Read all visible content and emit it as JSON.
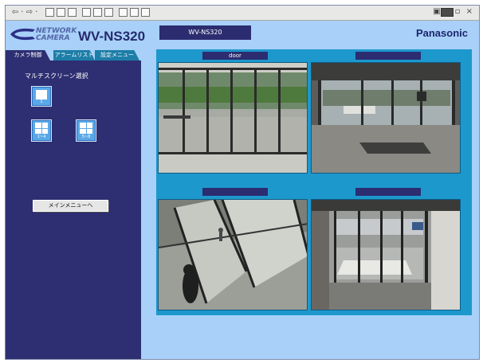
{
  "toolbar": {
    "nav_glyphs": "⇦ · ⇨ ·",
    "window_controls": "▣ - ▫ ×"
  },
  "header": {
    "logo_line1": "NETWORK",
    "logo_line2": "CAMERA",
    "model": "WV-NS320",
    "title_box": "WV-NS320",
    "brand": "Panasonic"
  },
  "tabs": [
    {
      "label": "カメラ制御",
      "active": true
    },
    {
      "label": "アラームリスト",
      "active": false
    },
    {
      "label": "設定メニュー",
      "active": false
    }
  ],
  "sidebar": {
    "title": "マルチスクリーン選択",
    "buttons": [
      {
        "label": "1"
      },
      {
        "label": "1~4"
      },
      {
        "label": "5~8"
      }
    ],
    "menu_button": "メインメニューへ"
  },
  "cameras": [
    {
      "label": "door"
    },
    {
      "label": ""
    },
    {
      "label": ""
    },
    {
      "label": ""
    }
  ],
  "colors": {
    "background": "#a8d0f8",
    "sidebar": "#2e2e72",
    "accent": "#1d98cc",
    "title_box": "#2c2c70"
  }
}
